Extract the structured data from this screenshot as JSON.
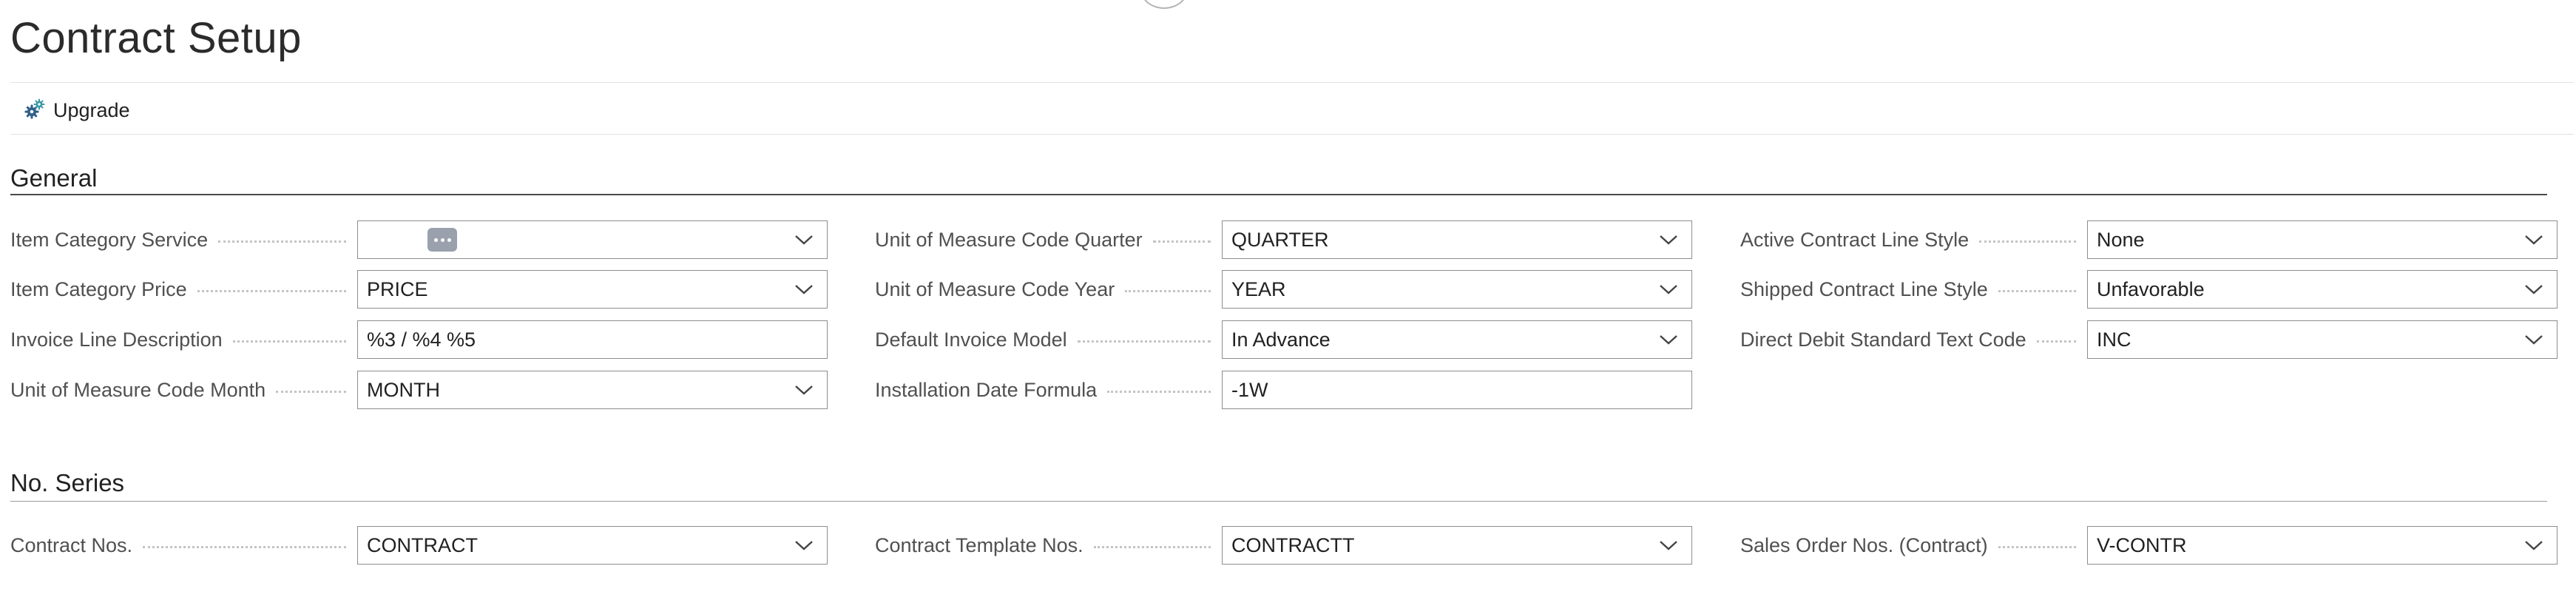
{
  "page": {
    "title": "Contract Setup"
  },
  "actions": {
    "upgrade_label": "Upgrade",
    "upgrade_icon": "gears-icon"
  },
  "general": {
    "title": "General",
    "fields": [
      {
        "label": "Item Category Service",
        "value": "",
        "type": "lookup-ellipsis"
      },
      {
        "label": "Item Category Price",
        "value": "PRICE",
        "type": "dropdown"
      },
      {
        "label": "Invoice Line Description",
        "value": "%3 / %4 %5",
        "type": "text"
      },
      {
        "label": "Unit of Measure Code Month",
        "value": "MONTH",
        "type": "dropdown"
      },
      {
        "label": "Unit of Measure Code Quarter",
        "value": "QUARTER",
        "type": "dropdown"
      },
      {
        "label": "Unit of Measure Code Year",
        "value": "YEAR",
        "type": "dropdown"
      },
      {
        "label": "Default Invoice Model",
        "value": "In Advance",
        "type": "dropdown"
      },
      {
        "label": "Installation Date Formula",
        "value": "-1W",
        "type": "text"
      },
      {
        "label": "Active Contract Line Style",
        "value": "None",
        "type": "dropdown"
      },
      {
        "label": "Shipped Contract Line Style",
        "value": "Unfavorable",
        "type": "dropdown"
      },
      {
        "label": "Direct Debit Standard Text Code",
        "value": "INC",
        "type": "dropdown"
      }
    ]
  },
  "no_series": {
    "title": "No. Series",
    "fields": [
      {
        "label": "Contract Nos.",
        "value": "CONTRACT",
        "type": "dropdown"
      },
      {
        "label": "Contract Template Nos.",
        "value": "CONTRACTT",
        "type": "dropdown"
      },
      {
        "label": "Sales Order Nos. (Contract)",
        "value": "V-CONTR",
        "type": "dropdown"
      }
    ]
  },
  "colors": {
    "background": "#ffffff",
    "text": "#212121",
    "label": "#505050",
    "input_border": "#8d8d8d",
    "ellipsis_button": "#9aa1ad",
    "icon_gear_blue": "#2f5f8a",
    "icon_gear_teal": "#3a9aa8"
  }
}
